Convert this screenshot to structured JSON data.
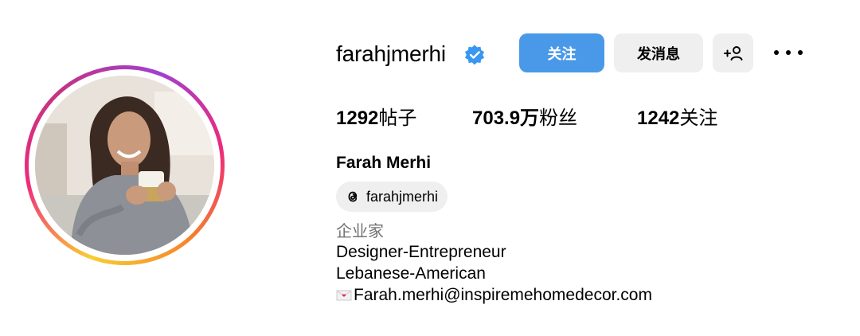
{
  "profile": {
    "username": "farahjmerhi",
    "full_name": "Farah Merhi",
    "category": "企业家",
    "threads_handle": "farahjmerhi",
    "bio": [
      "Designer-Entrepreneur",
      "Lebanese-American"
    ],
    "email": "Farah.merhi@inspiremehomedecor.com"
  },
  "actions": {
    "follow_label": "关注",
    "message_label": "发消息",
    "add_user_label": "+👤"
  },
  "stats": {
    "posts_count": "1292",
    "posts_label": "帖子",
    "followers_count": "703.9万",
    "followers_label": "粉丝",
    "following_count": "1242",
    "following_label": "关注"
  },
  "icons": {
    "verified": "verified-badge-icon",
    "threads": "threads-icon",
    "more": "more-options-icon",
    "envelope": "envelope-icon"
  },
  "colors": {
    "follow_button": "#4a99e9",
    "secondary_button": "#efefef",
    "verified_badge": "#3897f0",
    "category_text": "#737373"
  }
}
